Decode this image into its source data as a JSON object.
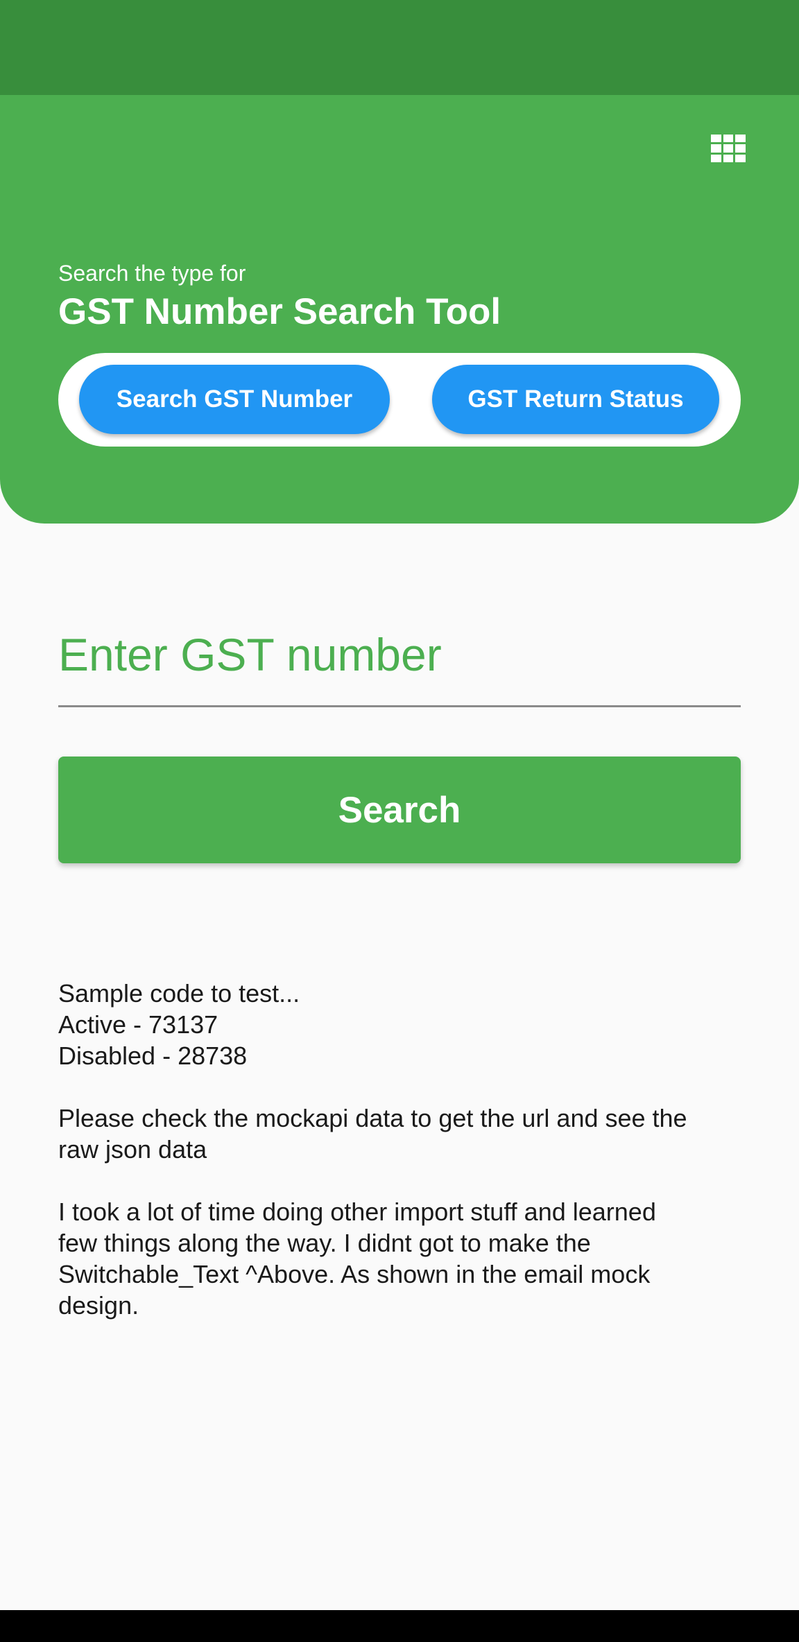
{
  "header": {
    "subtitle": "Search the type for",
    "title": "GST Number Search Tool",
    "menu_icon": "grid-icon",
    "toggle": {
      "options": [
        {
          "label": "Search GST Number"
        },
        {
          "label": "GST Return Status"
        }
      ]
    }
  },
  "form": {
    "input_placeholder": "Enter GST number",
    "input_value": "",
    "search_label": "Search"
  },
  "info": {
    "line1": "Sample code to test...",
    "line2": "Active - 73137",
    "line3": "Disabled - 28738",
    "para2_line1": "Please check the mockapi data to get the url and see the",
    "para2_line2": "raw json data",
    "para3_line1": "I took a lot of time doing other import stuff and learned",
    "para3_line2": "few things along the way. I didnt got to make the",
    "para3_line3": "Switchable_Text ^Above. As shown in the email mock",
    "para3_line4": "design."
  },
  "colors": {
    "status_bar": "#388e3c",
    "primary": "#4caf50",
    "accent": "#2196f3",
    "background": "#fafafa"
  }
}
